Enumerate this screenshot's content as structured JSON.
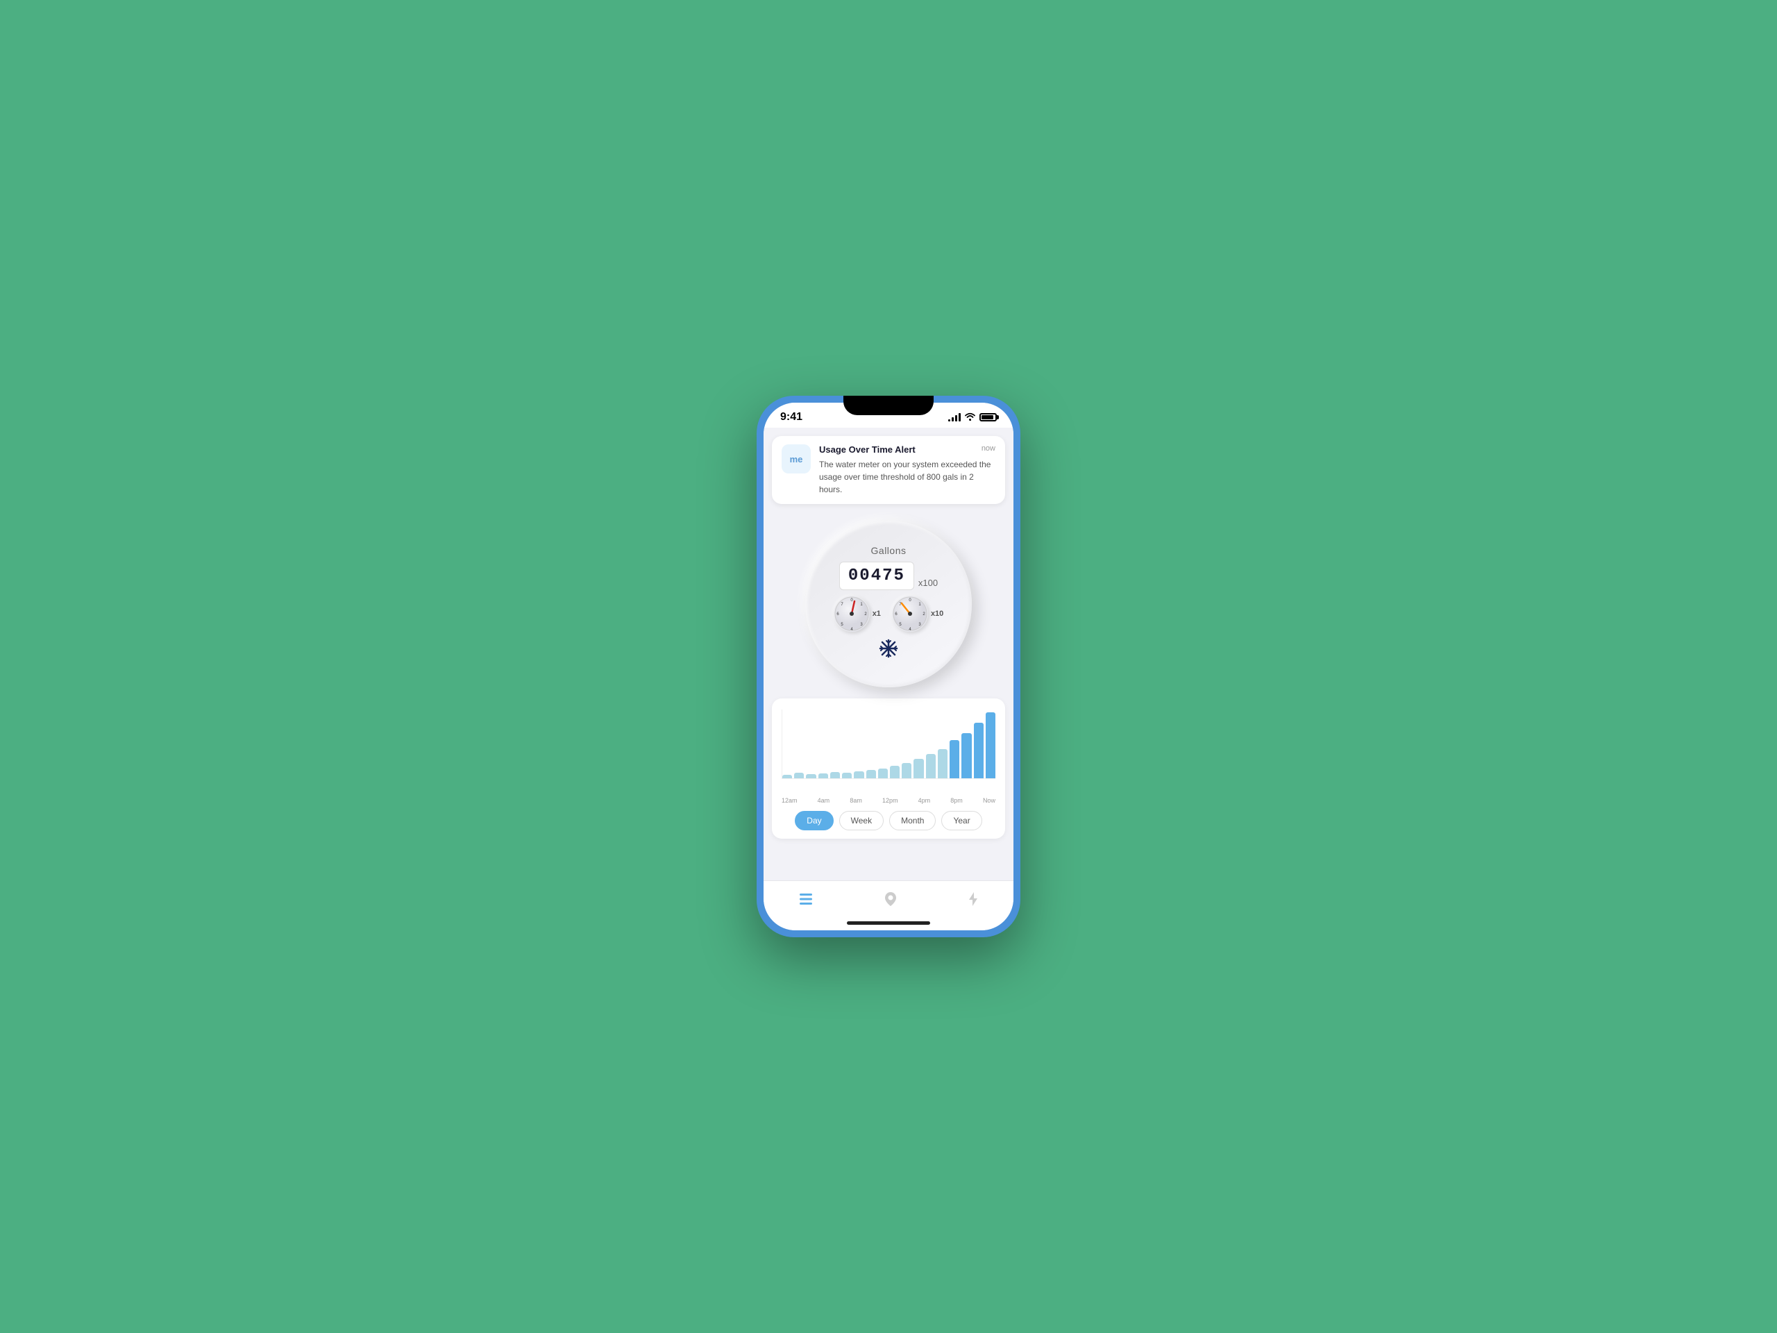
{
  "phone": {
    "statusBar": {
      "time": "9:41",
      "signalBars": [
        3,
        6,
        9,
        11
      ],
      "wifiSymbol": "wifi",
      "battery": "100"
    },
    "alert": {
      "iconText": "me",
      "title": "Usage Over Time Alert",
      "time": "now",
      "body": "The water meter on your system exceeded the usage over time threshold of 800 gals in 2 hours."
    },
    "meter": {
      "label": "Gallons",
      "digits": "00475",
      "multiplier": "x100",
      "dial1Label": "x1",
      "dial2Label": "x10"
    },
    "chart": {
      "xLabels": [
        "12am",
        "4am",
        "8am",
        "12pm",
        "4pm",
        "8pm",
        "Now"
      ],
      "bars": [
        5,
        8,
        6,
        7,
        9,
        8,
        10,
        12,
        14,
        18,
        22,
        28,
        35,
        42,
        55,
        65,
        80,
        95
      ],
      "filterButtons": [
        "Day",
        "Week",
        "Month",
        "Year"
      ],
      "activeFilter": "Day"
    },
    "bottomNav": {
      "items": [
        {
          "icon": "list",
          "label": "List",
          "active": true
        },
        {
          "icon": "location",
          "label": "Location",
          "active": false
        },
        {
          "icon": "bolt",
          "label": "Bolt",
          "active": false
        }
      ]
    }
  }
}
